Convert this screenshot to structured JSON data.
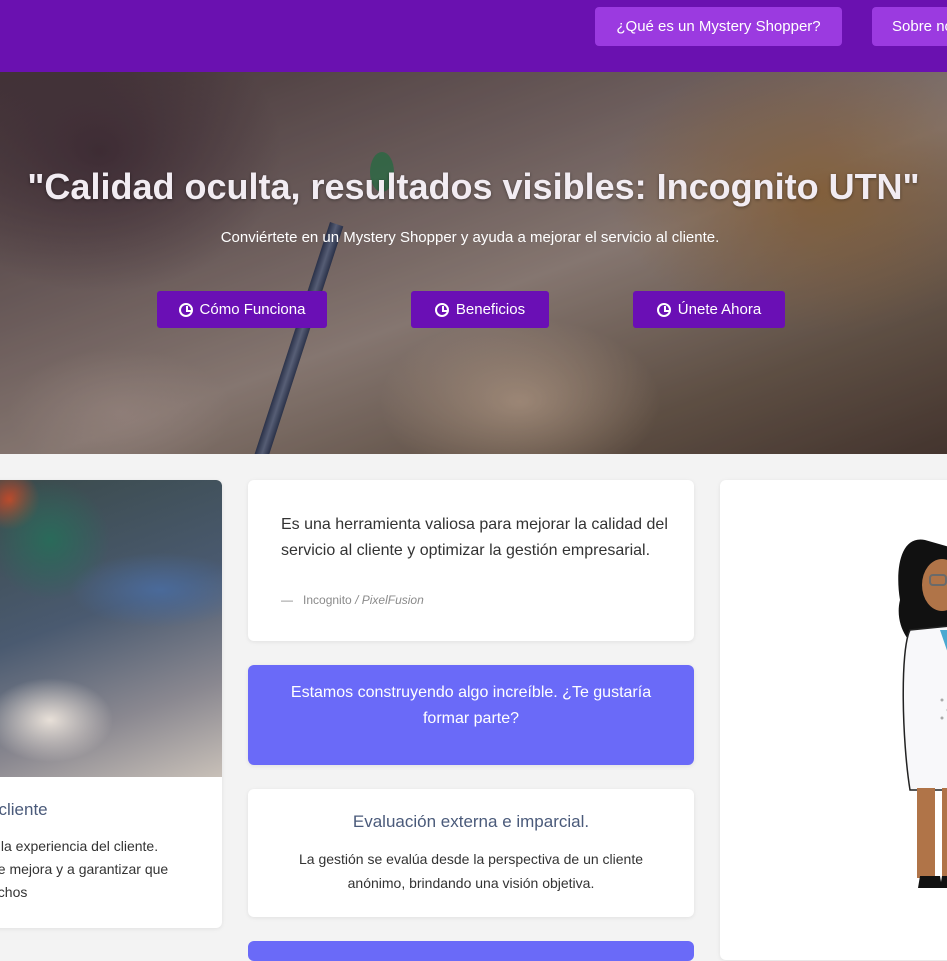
{
  "nav": {
    "items": [
      "¿Qué es un Mystery Shopper?",
      "Sobre no"
    ]
  },
  "hero": {
    "title": "\"Calidad oculta, resultados visibles: Incognito UTN\"",
    "subtitle": "Conviértete en un Mystery Shopper y ayuda a mejorar el servicio al cliente.",
    "buttons": [
      "Cómo Funciona",
      "Beneficios",
      "Únete Ahora"
    ],
    "button_icon": "clock-icon"
  },
  "left_card": {
    "heading": "l cliente",
    "lines": [
      "y la experiencia del cliente.",
      "de mejora y a garantizar que",
      "echos"
    ]
  },
  "quote_card": {
    "text": "Es una herramienta valiosa para mejorar la calidad del servicio al cliente y optimizar la gestión empresarial.",
    "dash": "—",
    "author": "Incognito",
    "source": "/ PixelFusion"
  },
  "cta_card": {
    "text": "Estamos construyendo algo increíble. ¿Te gustaría formar parte?"
  },
  "eval_card": {
    "title": "Evaluación externa e imparcial.",
    "text": "La gestión se evalúa desde la perspectiva de un cliente anónimo, brindando una visión objetiva."
  },
  "colors": {
    "navbar": "#6a11b0",
    "nav_button": "#9b3ae0",
    "hero_button": "#6a0fb5",
    "accent_card": "#6a6af8"
  }
}
